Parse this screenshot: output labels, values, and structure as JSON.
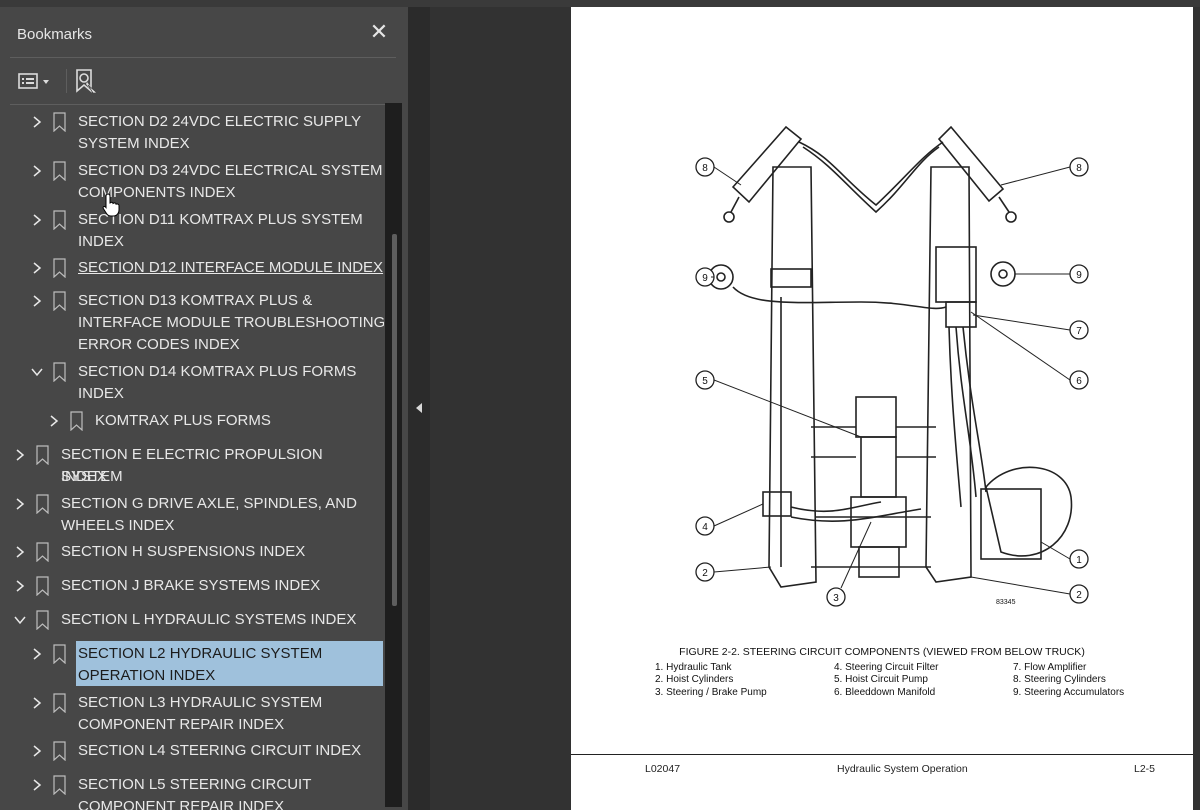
{
  "panel": {
    "title": "Bookmarks",
    "close_label": "✕",
    "toolbar": {
      "options_icon": "options-menu-icon",
      "find_icon": "find-bookmark-icon"
    }
  },
  "bookmarks": [
    {
      "label_lines": [
        "SECTION D2 24VDC ELECTRIC SUPPLY",
        "SYSTEM INDEX"
      ],
      "state": "collapsed",
      "level": 1
    },
    {
      "label_lines": [
        "SECTION D3 24VDC ELECTRICAL SYSTEM",
        "COMPONENTS INDEX"
      ],
      "state": "collapsed",
      "level": 1
    },
    {
      "label_lines": [
        "SECTION D11 KOMTRAX PLUS SYSTEM",
        "INDEX"
      ],
      "state": "collapsed",
      "level": 1
    },
    {
      "label_lines": [
        "SECTION D12 INTERFACE MODULE INDEX"
      ],
      "state": "collapsed",
      "level": 1,
      "hover": true
    },
    {
      "label_lines": [
        "SECTION D13 KOMTRAX PLUS &",
        "INTERFACE MODULE TROUBLESHOOTING &",
        "ERROR CODES INDEX"
      ],
      "state": "collapsed",
      "level": 1
    },
    {
      "label_lines": [
        "SECTION D14 KOMTRAX PLUS FORMS",
        "INDEX"
      ],
      "state": "expanded",
      "level": 1
    },
    {
      "label_lines": [
        "KOMTRAX PLUS FORMS"
      ],
      "state": "collapsed",
      "level": 2
    },
    {
      "label_lines": [
        "SECTION E ELECTRIC PROPULSION SYSTEM",
        "INDEX"
      ],
      "state": "collapsed",
      "level": 0
    },
    {
      "label_lines": [
        "SECTION G DRIVE AXLE, SPINDLES, AND",
        "WHEELS INDEX"
      ],
      "state": "collapsed",
      "level": 0
    },
    {
      "label_lines": [
        "SECTION H SUSPENSIONS INDEX"
      ],
      "state": "collapsed",
      "level": 0
    },
    {
      "label_lines": [
        "SECTION J BRAKE SYSTEMS INDEX"
      ],
      "state": "collapsed",
      "level": 0
    },
    {
      "label_lines": [
        "SECTION L HYDRAULIC SYSTEMS INDEX"
      ],
      "state": "expanded",
      "level": 0
    },
    {
      "label_lines": [
        "SECTION L2 HYDRAULIC SYSTEM",
        "OPERATION INDEX"
      ],
      "state": "collapsed",
      "level": 1,
      "selected": true
    },
    {
      "label_lines": [
        "SECTION L3 HYDRAULIC SYSTEM",
        "COMPONENT REPAIR INDEX"
      ],
      "state": "collapsed",
      "level": 1
    },
    {
      "label_lines": [
        "SECTION L4 STEERING CIRCUIT INDEX"
      ],
      "state": "collapsed",
      "level": 1
    },
    {
      "label_lines": [
        "SECTION L5 STEERING CIRCUIT",
        "COMPONENT REPAIR INDEX"
      ],
      "state": "collapsed",
      "level": 1
    }
  ],
  "document": {
    "figure_number": "83345",
    "callouts": [
      "1",
      "2",
      "3",
      "4",
      "5",
      "6",
      "7",
      "8",
      "9"
    ],
    "figure_title": "FIGURE 2-2. STEERING CIRCUIT COMPONENTS (VIEWED FROM BELOW TRUCK)",
    "legend": [
      [
        "1. Hydraulic Tank",
        "2. Hoist Cylinders",
        "3. Steering / Brake Pump"
      ],
      [
        "4. Steering Circuit Filter",
        "5. Hoist Circuit Pump",
        "6. Bleeddown Manifold"
      ],
      [
        "7. Flow Amplifier",
        "8. Steering Cylinders",
        "9. Steering Accumulators"
      ]
    ],
    "footer": {
      "left": "L02047",
      "center": "Hydraulic System Operation",
      "right": "L2-5"
    }
  }
}
